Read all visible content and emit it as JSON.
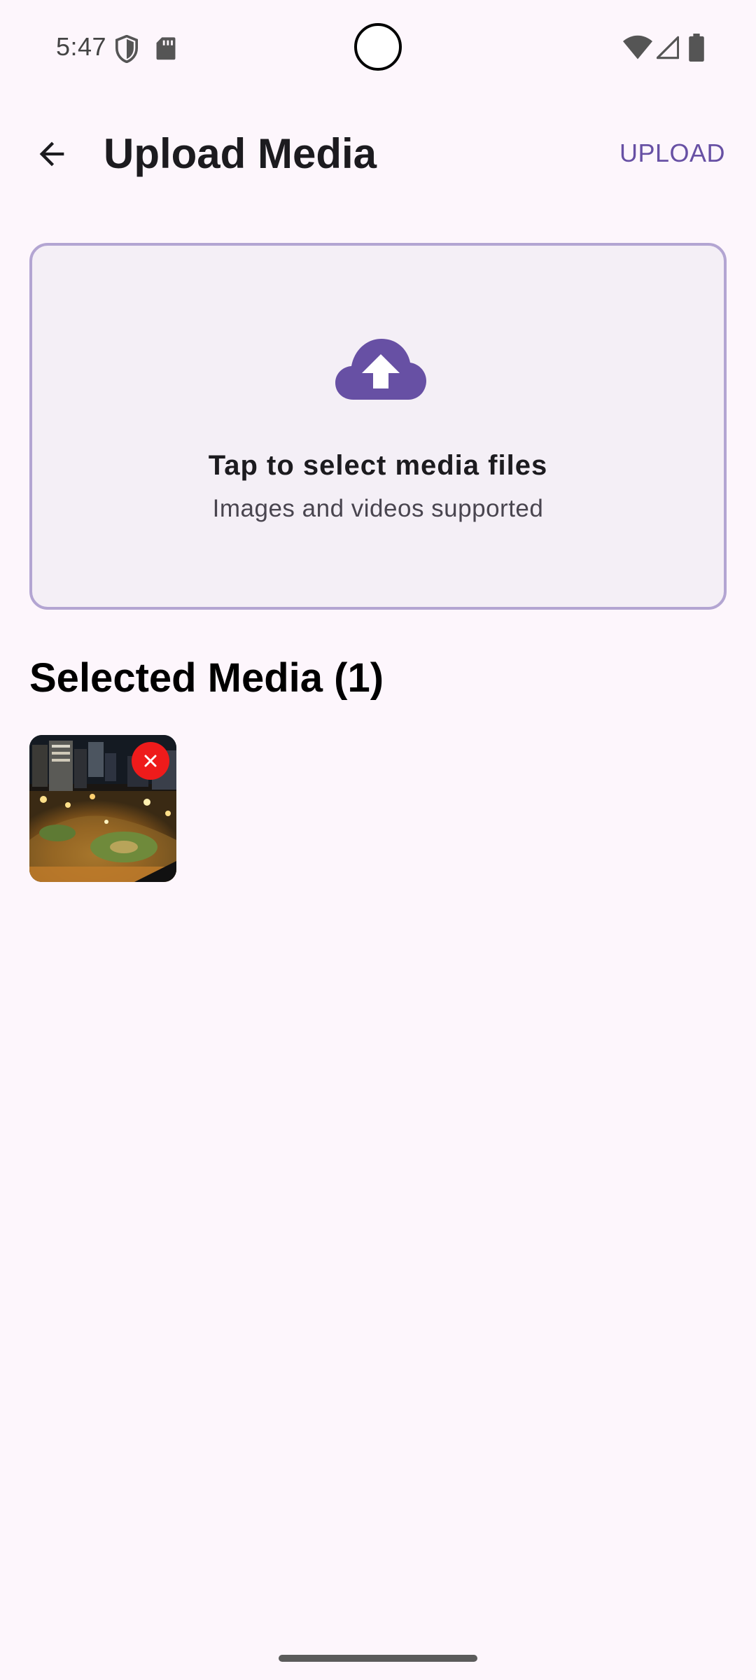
{
  "status_bar": {
    "time": "5:47",
    "icons": [
      "shield-icon",
      "sd-card-icon",
      "wifi-icon",
      "cell-signal-icon",
      "battery-icon"
    ]
  },
  "app_bar": {
    "title": "Upload Media",
    "action_label": "UPLOAD",
    "back_icon": "arrow-back-icon"
  },
  "drop_zone": {
    "icon": "cloud-upload-icon",
    "title": "Tap to select media files",
    "subtitle": "Images and videos supported"
  },
  "selected_media": {
    "title": "Selected Media (1)",
    "items": [
      {
        "name": "city-night-roundabout-thumbnail",
        "remove_icon": "close-icon"
      }
    ]
  },
  "colors": {
    "background": "#FDF6FC",
    "primary": "#6750A4",
    "drop_zone_border": "#B3A5D2",
    "drop_zone_fill": "#F4EFF6",
    "remove_button": "#EE1B1B"
  }
}
